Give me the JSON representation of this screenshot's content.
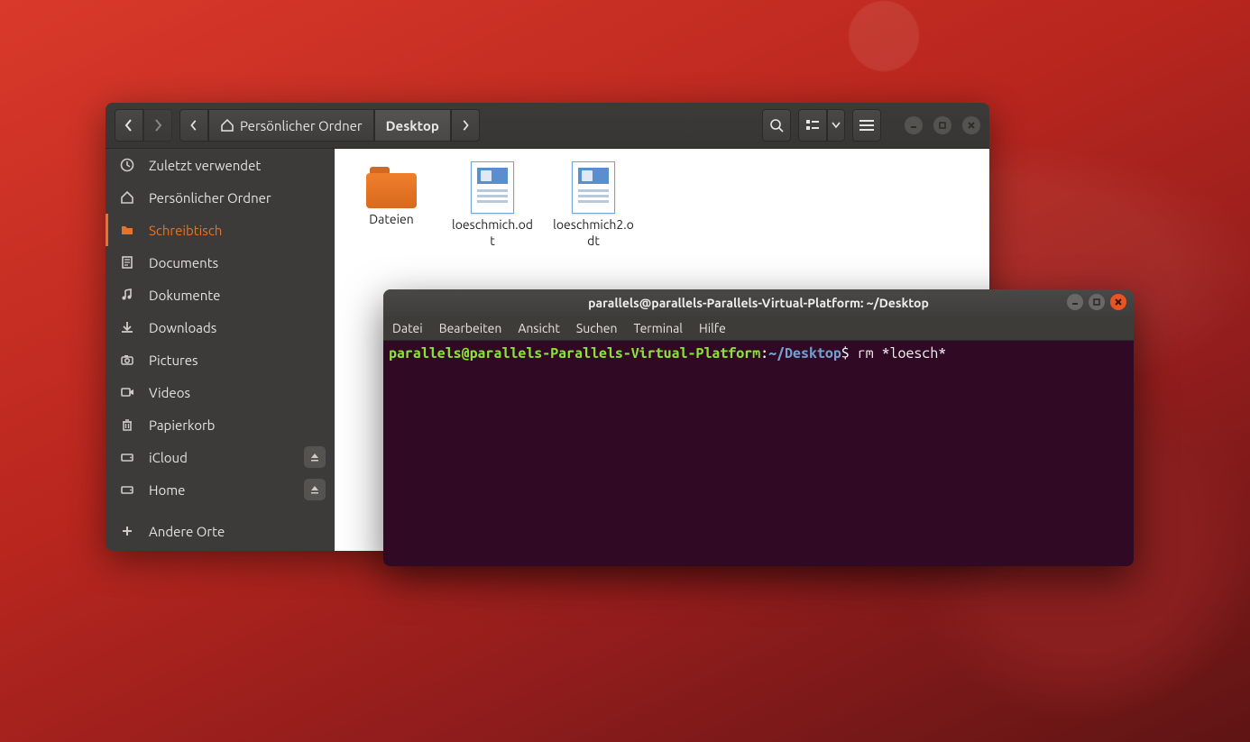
{
  "files": {
    "breadcrumb": {
      "parent": "Persönlicher Ordner",
      "current": "Desktop"
    },
    "sidebar": [
      {
        "label": "Zuletzt verwendet",
        "icon": "clock"
      },
      {
        "label": "Persönlicher Ordner",
        "icon": "home"
      },
      {
        "label": "Schreibtisch",
        "icon": "folder",
        "active": true
      },
      {
        "label": "Documents",
        "icon": "document"
      },
      {
        "label": "Dokumente",
        "icon": "music"
      },
      {
        "label": "Downloads",
        "icon": "download"
      },
      {
        "label": "Pictures",
        "icon": "camera"
      },
      {
        "label": "Videos",
        "icon": "video"
      },
      {
        "label": "Papierkorb",
        "icon": "trash"
      },
      {
        "label": "iCloud",
        "icon": "drive",
        "eject": true
      },
      {
        "label": "Home",
        "icon": "drive",
        "eject": true
      },
      {
        "label": "Andere Orte",
        "icon": "plus"
      }
    ],
    "items": [
      {
        "label": "Dateien",
        "type": "folder"
      },
      {
        "label": "loeschmich.odt",
        "type": "odt"
      },
      {
        "label": "loeschmich2.odt",
        "type": "odt"
      }
    ]
  },
  "terminal": {
    "title": "parallels@parallels-Parallels-Virtual-Platform: ~/Desktop",
    "menu": {
      "datei": "Datei",
      "bearbeiten": "Bearbeiten",
      "ansicht": "Ansicht",
      "suchen": "Suchen",
      "terminal": "Terminal",
      "hilfe": "Hilfe"
    },
    "prompt": {
      "userhost": "parallels@parallels-Parallels-Virtual-Platform",
      "sep1": ":",
      "path": "~/Desktop",
      "sigil": "$ ",
      "command": "rm *loesch*"
    }
  }
}
